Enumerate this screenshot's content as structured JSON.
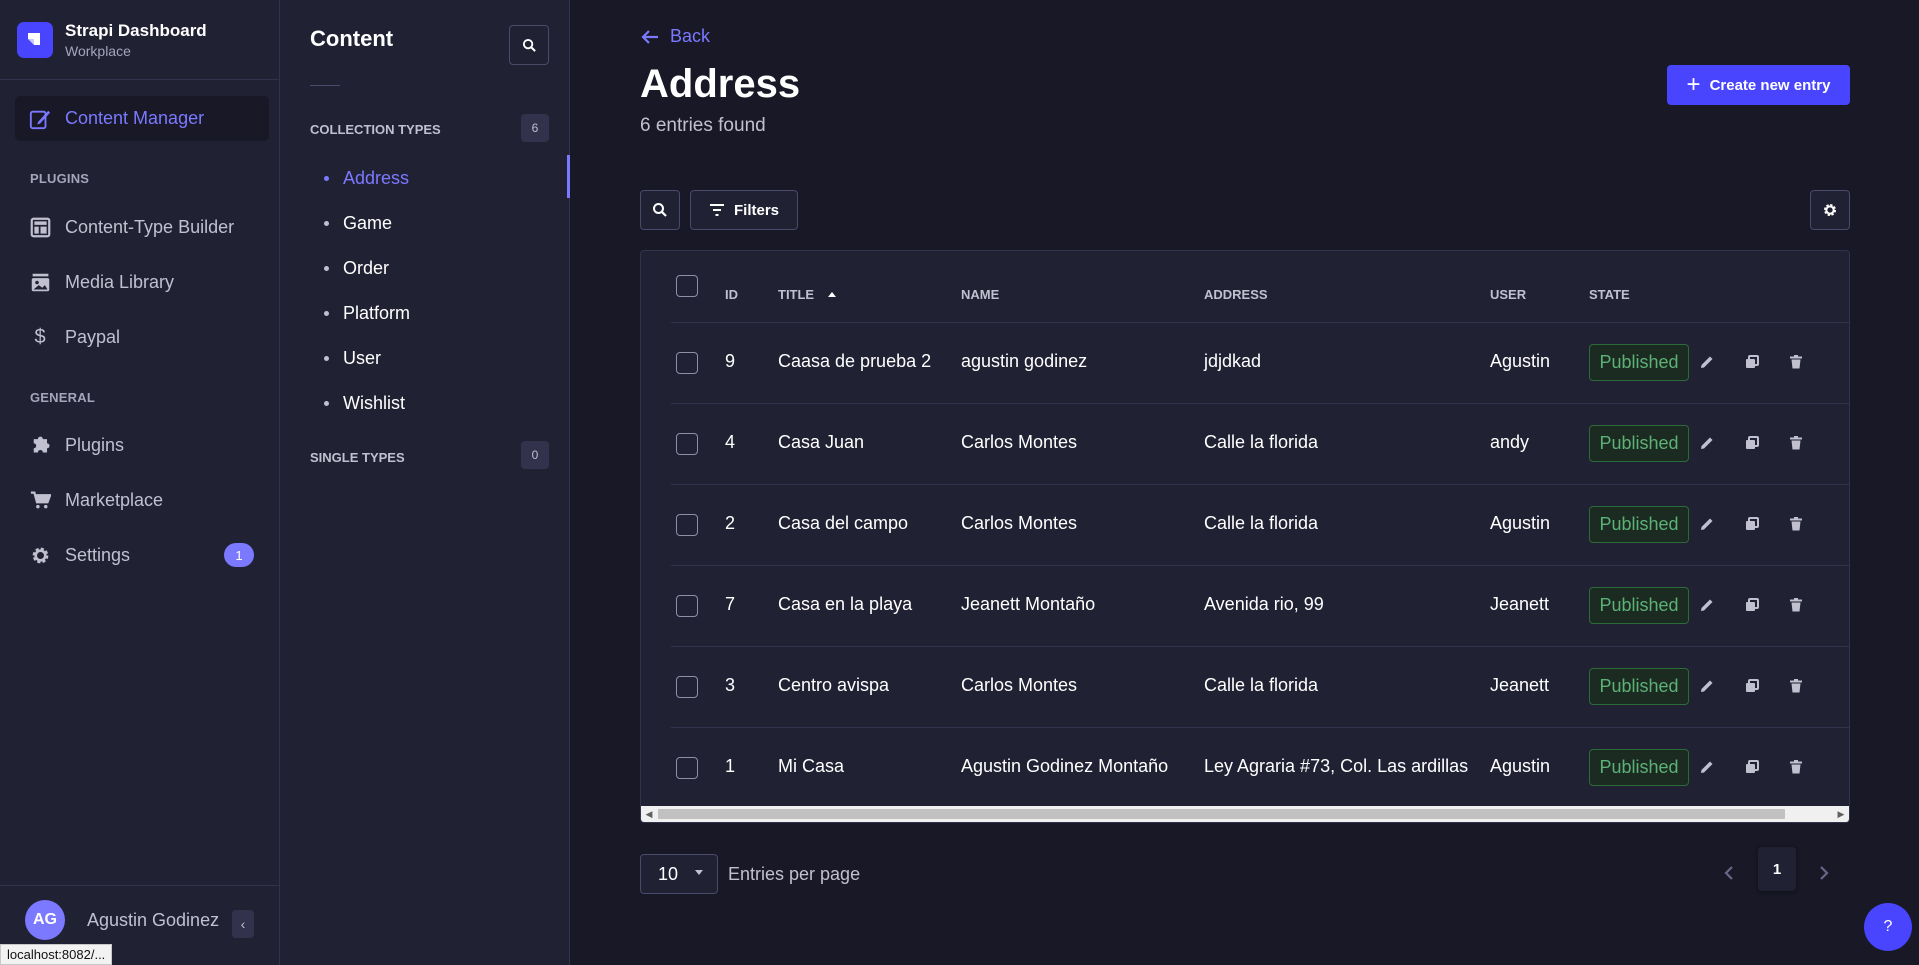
{
  "brand": {
    "title": "Strapi Dashboard",
    "subtitle": "Workplace",
    "icon": "strapi-logo"
  },
  "nav": {
    "active": {
      "label": "Content Manager",
      "icon": "feather-pen-icon"
    },
    "plugins_section": "PLUGINS",
    "plugins": [
      {
        "label": "Content-Type Builder",
        "icon": "layout-icon"
      },
      {
        "label": "Media Library",
        "icon": "image-icon"
      },
      {
        "label": "Paypal",
        "icon": "dollar-icon"
      }
    ],
    "general_section": "GENERAL",
    "general": [
      {
        "label": "Plugins",
        "icon": "puzzle-icon"
      },
      {
        "label": "Marketplace",
        "icon": "cart-icon"
      },
      {
        "label": "Settings",
        "icon": "gear-icon",
        "badge": "1"
      }
    ]
  },
  "user": {
    "initials": "AG",
    "name": "Agustin Godinez"
  },
  "status_url": "localhost:8082/...",
  "subnav": {
    "title": "Content",
    "collection_label": "COLLECTION TYPES",
    "collection_count": "6",
    "collection_items": [
      "Address",
      "Game",
      "Order",
      "Platform",
      "User",
      "Wishlist"
    ],
    "active_item": "Address",
    "single_label": "SINGLE TYPES",
    "single_count": "0"
  },
  "main": {
    "back_label": "Back",
    "title": "Address",
    "entries_found": "6 entries found",
    "create_label": "Create new entry",
    "filters_label": "Filters"
  },
  "table": {
    "headers": {
      "id": "ID",
      "title": "TITLE",
      "name": "NAME",
      "address": "ADDRESS",
      "user": "USER",
      "state": "STATE"
    },
    "sort": {
      "column": "TITLE",
      "direction": "ascending"
    },
    "rows": [
      {
        "id": "9",
        "title": "Caasa de prueba 2",
        "name": "agustin godinez",
        "address": "jdjdkad",
        "user": "Agustin",
        "state": "Published"
      },
      {
        "id": "4",
        "title": "Casa Juan",
        "name": "Carlos Montes",
        "address": "Calle la florida",
        "user": "andy",
        "state": "Published"
      },
      {
        "id": "2",
        "title": "Casa del campo",
        "name": "Carlos Montes",
        "address": "Calle la florida",
        "user": "Agustin",
        "state": "Published"
      },
      {
        "id": "7",
        "title": "Casa en la playa",
        "name": "Jeanett Montaño",
        "address": "Avenida rio, 99",
        "user": "Jeanett",
        "state": "Published"
      },
      {
        "id": "3",
        "title": "Centro avispa",
        "name": "Carlos Montes",
        "address": "Calle la florida",
        "user": "Jeanett",
        "state": "Published"
      },
      {
        "id": "1",
        "title": "Mi Casa",
        "name": "Agustin Godinez Montaño",
        "address": "Ley Agraria #73, Col. Las ardillas",
        "user": "Agustin",
        "state": "Published"
      }
    ]
  },
  "pagination": {
    "per_page": "10",
    "per_page_label": "Entries per page",
    "current_page": "1"
  },
  "help": "?",
  "colors": {
    "background": "#181826",
    "panel": "#212134",
    "border": "#32324d",
    "accent": "#4945ff",
    "accent_light": "#7b79ff",
    "published_text": "#5cb176",
    "published_bg": "#1c2b21"
  }
}
